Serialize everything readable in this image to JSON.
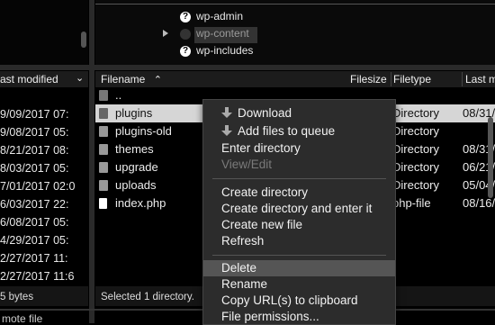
{
  "tree": {
    "items": [
      {
        "label": "wp-admin"
      },
      {
        "label": "wp-content"
      },
      {
        "label": "wp-includes"
      }
    ]
  },
  "left_pane": {
    "header": "ast modified",
    "rows": [
      "9/09/2017 07:",
      "9/08/2017 05:",
      "8/21/2017 08:",
      "8/03/2017 05:",
      "7/01/2017 02:0",
      "6/03/2017 22:",
      "6/08/2017 05:",
      "4/29/2017 05:",
      "2/27/2017 11:",
      "2/27/2017 11:6"
    ],
    "status": "5 bytes"
  },
  "right_pane": {
    "headers": {
      "filename": "Filename",
      "filesize": "Filesize",
      "filetype": "Filetype",
      "lastmod": "Last m"
    },
    "rows": [
      {
        "name": "..",
        "type": "",
        "mod": ""
      },
      {
        "name": "plugins",
        "type": "Directory",
        "mod": "08/31/"
      },
      {
        "name": "plugins-old",
        "type": "Directory",
        "mod": ""
      },
      {
        "name": "themes",
        "type": "Directory",
        "mod": "08/31/"
      },
      {
        "name": "upgrade",
        "type": "Directory",
        "mod": "06/21/"
      },
      {
        "name": "uploads",
        "type": "Directory",
        "mod": "05/04/"
      },
      {
        "name": "index.php",
        "type": "php-file",
        "mod": "08/16/"
      }
    ],
    "status": "Selected 1 directory."
  },
  "bottom": {
    "text": "mote file"
  },
  "context_menu": {
    "items": [
      {
        "label": "Download"
      },
      {
        "label": "Add files to queue"
      },
      {
        "label": "Enter directory"
      },
      {
        "label": "View/Edit"
      },
      {
        "label": "Create directory"
      },
      {
        "label": "Create directory and enter it"
      },
      {
        "label": "Create new file"
      },
      {
        "label": "Refresh"
      },
      {
        "label": "Delete"
      },
      {
        "label": "Rename"
      },
      {
        "label": "Copy URL(s) to clipboard"
      },
      {
        "label": "File permissions..."
      }
    ]
  }
}
